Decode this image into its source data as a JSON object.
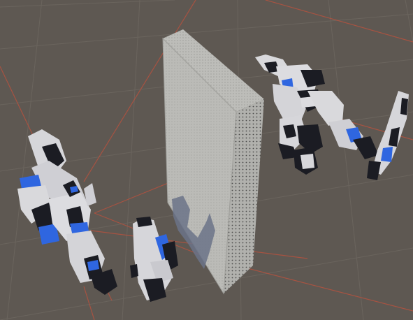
{
  "scene": {
    "background_color": "#5e5852",
    "grid_color": "#6c665f",
    "ray_color": "#b4523f",
    "wall_color": "#b7b7b3",
    "robot_white": "#d9d9dc",
    "robot_dark": "#1b1c23",
    "robot_blue": "#2f66e0",
    "objects": [
      "floor-grid",
      "debug-rays",
      "wall-panel",
      "wall-shadow",
      "mech-robot-left-lying",
      "mech-robot-right-standing",
      "mech-gun-arm-center",
      "mech-gun-arm-right"
    ]
  }
}
